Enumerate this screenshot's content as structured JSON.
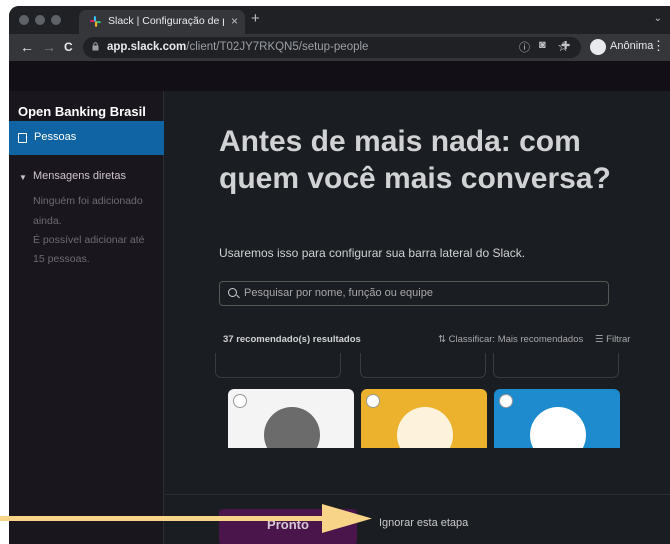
{
  "browser": {
    "tab_title": "Slack | Configuração de pessoas",
    "tab_close": "×",
    "new_tab": "+",
    "url_host": "app.slack.com",
    "url_path": "/client/T02JY7RKQN5/setup-people",
    "profile_label": "Anônima",
    "nav": {
      "back": "←",
      "forward": "→",
      "reload": "C"
    },
    "star": "☆",
    "menu": "⋮"
  },
  "sidebar": {
    "workspace_name": "Open Banking Brasil",
    "active_item": "Pessoas",
    "dm_header": "Mensagens diretas",
    "dm_note_lines": [
      "Ninguém foi adicionado",
      "ainda.",
      "É possível adicionar até",
      "15 pessoas."
    ]
  },
  "main": {
    "heading": "Antes de mais nada: com quem você mais conversa?",
    "subtitle": "Usaremos isso para configurar sua barra lateral do Slack.",
    "search_placeholder": "Pesquisar por nome, função ou equipe",
    "results_count": "37 recomendado(s) resultados",
    "sort_label": "Classificar: Mais recomendados",
    "filter_label": "Filtrar",
    "cards": [
      {
        "bg": "#f4f4f4",
        "avatar": "#6b6b6b"
      },
      {
        "bg": "#ecb22e",
        "avatar": "#fdf3dc"
      },
      {
        "bg": "#1d8bcd",
        "avatar": "#ffffff"
      }
    ]
  },
  "footer": {
    "next_button": "Pronto",
    "skip_link": "Ignorar esta etapa"
  },
  "colors": {
    "accent": "#1164a3",
    "primary_button": "#4a154b",
    "arrow": "#f7d488"
  },
  "icons": [
    "slack-favicon-icon",
    "lock-icon",
    "star-icon",
    "extension-icon",
    "camera-icon",
    "incognito-icon",
    "contact-card-icon",
    "search-icon",
    "sort-icon",
    "filter-icon",
    "annotation-arrow-icon"
  ]
}
